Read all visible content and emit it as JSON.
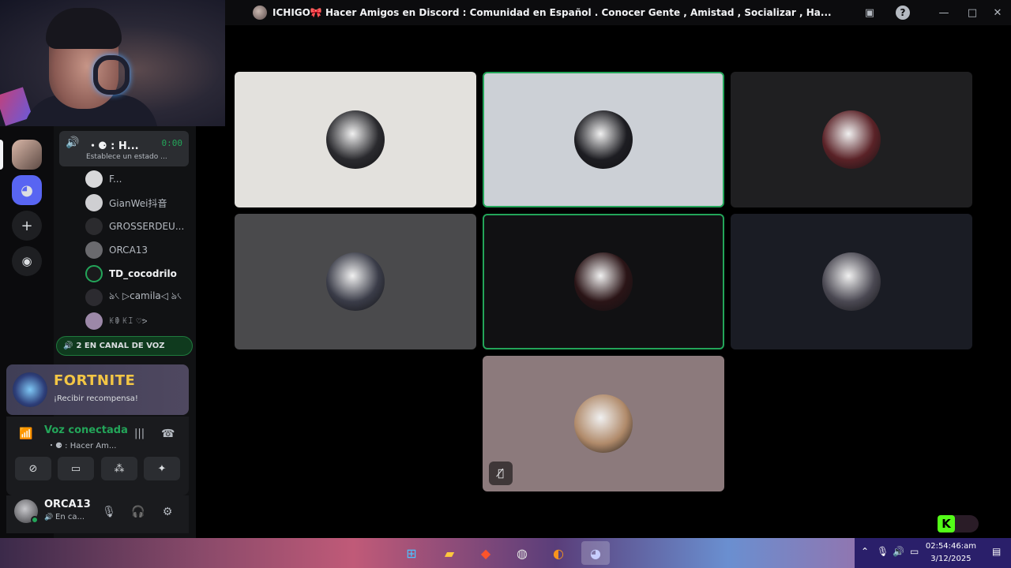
{
  "window": {
    "title": "ICHIGO🎀 Hacer Amigos en Discord : Comunidad en Español . Conocer Gente , Amistad , Socializar , Ha..."
  },
  "channel": {
    "name": "・⚈ : H...",
    "timer": "0:00",
    "status": "Establece un estado ..."
  },
  "members": [
    {
      "name": "F..."
    },
    {
      "name": "GianWei抖音"
    },
    {
      "name": "GROSSERDEU..."
    },
    {
      "name": "ORCA13"
    },
    {
      "name": "TD_cocodrilo"
    },
    {
      "name": "ঌ৻ ▷camila◁ ঌ৻"
    },
    {
      "name": "ꀘꂦ ꀘꀤ ♡ᕗ"
    }
  ],
  "voice_channel_pill": "2 EN CANAL DE VOZ",
  "promo": {
    "brand": "FORTNITE",
    "reward": "¡Recibir recompensa!"
  },
  "voice_panel": {
    "status": "Voz conectada",
    "channel": "・⚈ : Hacer Am..."
  },
  "user": {
    "name": "ORCA13",
    "status": "En ca..."
  },
  "tiles": [
    {
      "bg": "#e3e1dd",
      "avatar": "#2a2a2e",
      "speaking": false
    },
    {
      "bg": "#ccd0d6",
      "avatar": "#1d1d22",
      "speaking": true
    },
    {
      "bg": "#1f1f21",
      "avatar": "#5a2227",
      "speaking": false
    },
    {
      "bg": "#4a4a4c",
      "avatar": "#3a3c48",
      "speaking": false
    },
    {
      "bg": "#111113",
      "avatar": "#2a1416",
      "speaking": true
    },
    {
      "bg": "#1a1c24",
      "avatar": "#4a4852",
      "speaking": false
    },
    {
      "bg": "#8c7a7c",
      "avatar": "#b08a6a",
      "speaking": false,
      "muted": true
    }
  ],
  "overlay_logo": "K",
  "clock": {
    "time": "02:54:46:am",
    "date": "3/12/2025"
  },
  "colors": {
    "discord_green": "#23a559",
    "discord_bg": "#111214",
    "accent_blurple": "#5865f2"
  }
}
